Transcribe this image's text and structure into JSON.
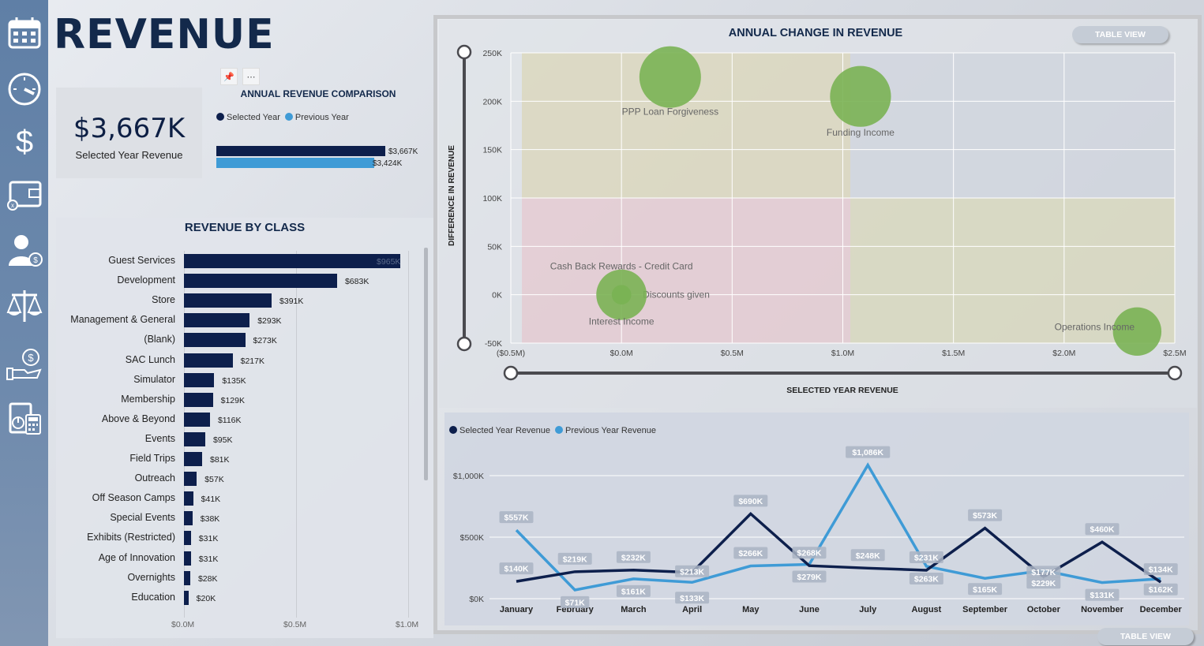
{
  "page_title": "REVENUE",
  "nav_icons": [
    "calendar-icon",
    "speedometer-icon",
    "dollar-icon",
    "wallet-icon",
    "person-dollar-icon",
    "scales-icon",
    "hand-money-icon",
    "calculator-report-icon"
  ],
  "kpi": {
    "value": "$3,667K",
    "label": "Selected Year Revenue"
  },
  "visual_tools": {
    "pin": "📌",
    "more": "⋯"
  },
  "comparison": {
    "title": "ANNUAL REVENUE COMPARISON",
    "legend": [
      {
        "label": "Selected Year",
        "color": "#0d1f4c"
      },
      {
        "label": "Previous Year",
        "color": "#3f9bd6"
      }
    ],
    "chart_data": {
      "type": "bar",
      "categories": [
        "Selected Year",
        "Previous Year"
      ],
      "values": [
        3667,
        3424
      ],
      "labels": [
        "$3,667K",
        "$3,424K"
      ]
    }
  },
  "class_chart": {
    "title": "REVENUE BY CLASS",
    "chart_data": {
      "type": "bar",
      "orientation": "horizontal",
      "categories": [
        "Guest Services",
        "Development",
        "Store",
        "Management & General",
        "(Blank)",
        "SAC Lunch",
        "Simulator",
        "Membership",
        "Above & Beyond",
        "Events",
        "Field Trips",
        "Outreach",
        "Off Season Camps",
        "Special Events",
        "Exhibits (Restricted)",
        "Age of Innovation",
        "Overnights",
        "Education"
      ],
      "values": [
        965,
        683,
        391,
        293,
        273,
        217,
        135,
        129,
        116,
        95,
        81,
        57,
        41,
        38,
        31,
        31,
        28,
        20
      ],
      "labels": [
        "$965K",
        "$683K",
        "$391K",
        "$293K",
        "$273K",
        "$217K",
        "$135K",
        "$129K",
        "$116K",
        "$95K",
        "$81K",
        "$57K",
        "$41K",
        "$38K",
        "$31K",
        "$31K",
        "$28K",
        "$20K"
      ],
      "x_ticks": [
        "$0.0M",
        "$0.5M",
        "$1.0M"
      ],
      "xlim": [
        0,
        1000
      ]
    }
  },
  "scatter": {
    "title": "ANNUAL CHANGE IN REVENUE",
    "table_view_label": "TABLE VIEW",
    "chart_data": {
      "type": "scatter",
      "xlabel": "SELECTED YEAR REVENUE",
      "ylabel": "DIFFERENCE IN REVENUE",
      "xlim": [
        -0.5,
        2.5
      ],
      "ylim": [
        -50,
        250
      ],
      "x_ticks": [
        "($0.5M)",
        "$0.0M",
        "$0.5M",
        "$1.0M",
        "$1.5M",
        "$2.0M",
        "$2.5M"
      ],
      "y_ticks": [
        "-50K",
        "0K",
        "50K",
        "100K",
        "150K",
        "200K",
        "250K"
      ],
      "points": [
        {
          "label": "PPP Loan Forgiveness",
          "x": 0.22,
          "y": 225,
          "size": 1.0
        },
        {
          "label": "Funding Income",
          "x": 1.08,
          "y": 205,
          "size": 0.98
        },
        {
          "label": "Cash Back Rewards - Credit Card",
          "x": 0.0,
          "y": 0,
          "size": 0.1
        },
        {
          "label": "Discounts given",
          "x": 0.0,
          "y": 0,
          "size": 0.1
        },
        {
          "label": "Interest Income",
          "x": 0.0,
          "y": 0,
          "size": 0.67
        },
        {
          "label": "Operations Income",
          "x": 2.33,
          "y": -38,
          "size": 0.62
        }
      ]
    }
  },
  "monthly": {
    "legend": [
      {
        "label": "Selected Year Revenue",
        "color": "#0d1f4c"
      },
      {
        "label": "Previous Year Revenue",
        "color": "#3f9bd6"
      }
    ],
    "table_view_label": "TABLE VIEW",
    "chart_data": {
      "type": "line",
      "categories": [
        "January",
        "February",
        "March",
        "April",
        "May",
        "June",
        "July",
        "August",
        "September",
        "October",
        "November",
        "December"
      ],
      "y_ticks": [
        "$0K",
        "$500K",
        "$1,000K"
      ],
      "ylim": [
        0,
        1000
      ],
      "series": [
        {
          "name": "Selected Year Revenue",
          "values": [
            140,
            219,
            232,
            213,
            690,
            268,
            248,
            231,
            573,
            177,
            460,
            134
          ],
          "labels": [
            "$140K",
            "$219K",
            "$232K",
            "$213K",
            "$690K",
            "$268K",
            "$248K",
            "$231K",
            "$573K",
            "$177K",
            "$460K",
            "$134K"
          ]
        },
        {
          "name": "Previous Year Revenue",
          "values": [
            557,
            71,
            161,
            133,
            266,
            279,
            1086,
            263,
            165,
            229,
            131,
            162
          ],
          "labels": [
            "$557K",
            "$71K",
            "$161K",
            "$133K",
            "$266K",
            "$279K",
            "$1,086K",
            "$263K",
            "$165K",
            "$229K",
            "$131K",
            "$162K"
          ]
        }
      ]
    }
  }
}
